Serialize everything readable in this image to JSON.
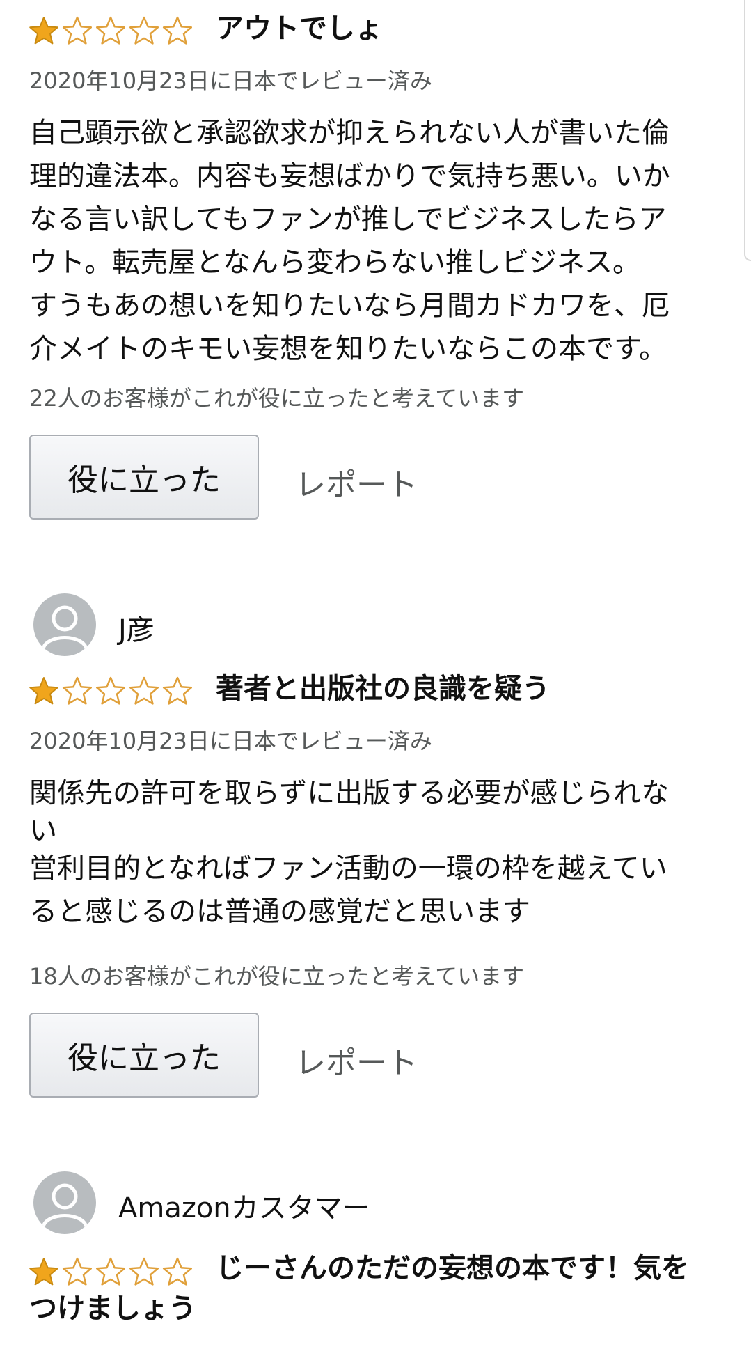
{
  "reviews": [
    {
      "rating": 1,
      "max_rating": 5,
      "title": "アウトでしょ",
      "date": "2020年10月23日に日本でレビュー済み",
      "body_lines": [
        "自己顕示欲と承認欲求が抑えられない人が書いた倫",
        "理的違法本。内容も妄想ばかりで気持ち悪い。いか",
        "なる言い訳してもファンが推しでビジネスしたらア",
        "ウト。転売屋となんら変わらない推しビジネス。",
        "すうもあの想いを知りたいなら月間カドカワを、厄",
        "介メイトのキモい妄想を知りたいならこの本です。"
      ],
      "helpful_text": "22人のお客様がこれが役に立ったと考えています",
      "helpful_button": "役に立った",
      "report_link": "レポート"
    },
    {
      "reviewer": "J彦",
      "rating": 1,
      "max_rating": 5,
      "title": "著者と出版社の良識を疑う",
      "date": "2020年10月23日に日本でレビュー済み",
      "body_lines": [
        "関係先の許可を取らずに出版する必要が感じられな",
        "い",
        "営利目的となればファン活動の一環の枠を越えてい",
        "ると感じるのは普通の感覚だと思います"
      ],
      "helpful_text": "18人のお客様がこれが役に立ったと考えています",
      "helpful_button": "役に立った",
      "report_link": "レポート"
    },
    {
      "reviewer": "Amazonカスタマー",
      "rating": 1,
      "max_rating": 5,
      "title_lines": [
        "じーさんのただの妄想の本です！気を",
        "つけましょう"
      ]
    }
  ],
  "colors": {
    "star_filled": "#f0a51c",
    "star_empty_outline": "#e0a03a",
    "secondary_text": "#565959",
    "button_border": "#a9adb3"
  },
  "icons": [
    "star-filled-icon",
    "star-empty-icon",
    "default-avatar-icon"
  ]
}
